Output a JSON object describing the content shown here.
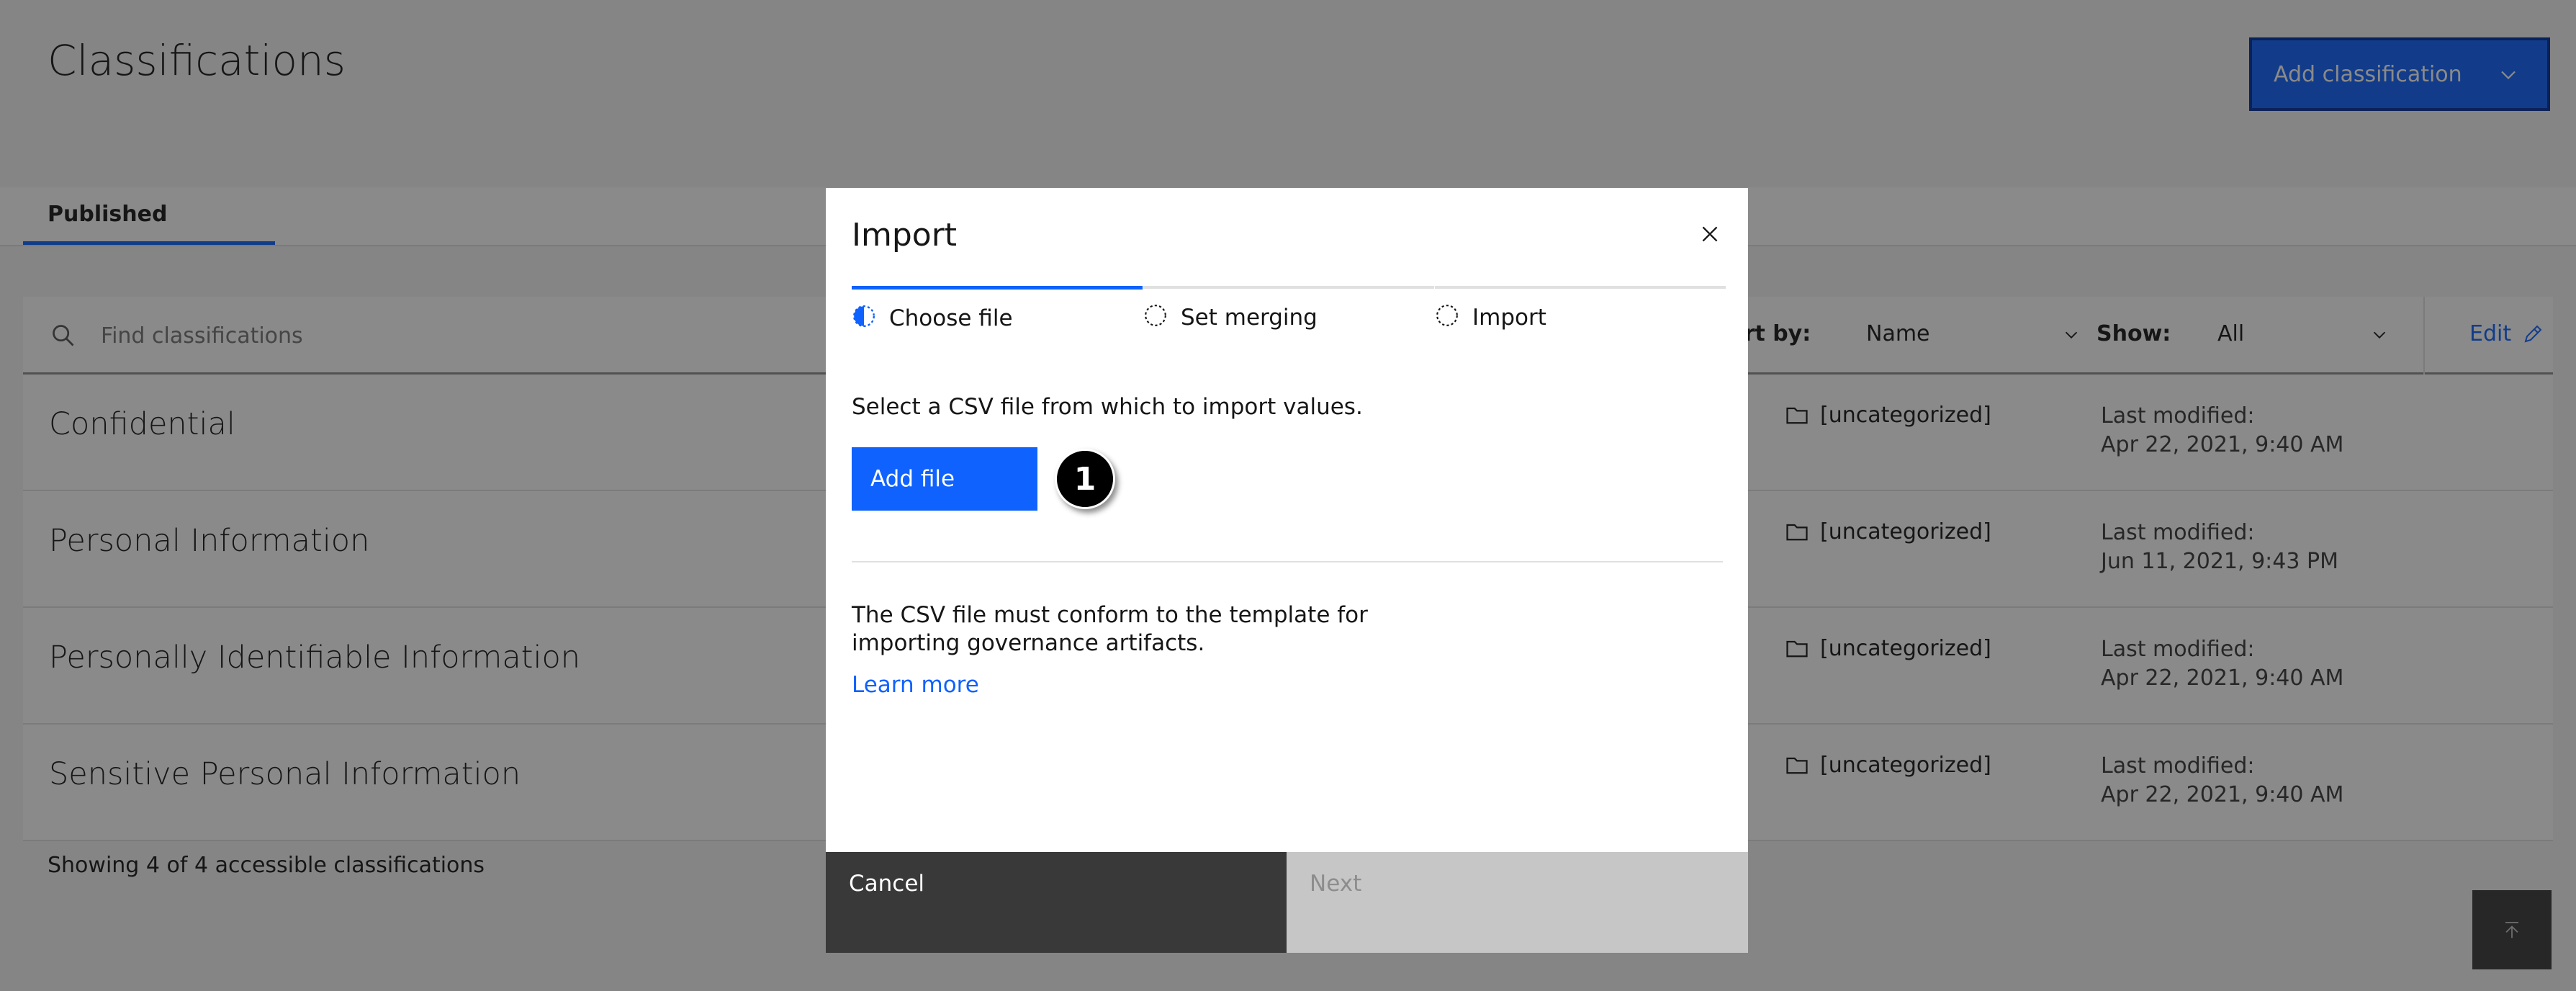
{
  "page": {
    "title": "Classifications",
    "add_button_label": "Add classification",
    "tabs": [
      {
        "label": "Published"
      }
    ],
    "search": {
      "placeholder": "Find classifications"
    },
    "sort_label": "ort by:",
    "sort_value": "Name",
    "show_label": "Show:",
    "show_value": "All",
    "edit_label": "Edit",
    "rows": [
      {
        "name": "Confidential",
        "category": "[uncategorized]",
        "modified_label": "Last modified:",
        "modified": "Apr 22, 2021, 9:40 AM"
      },
      {
        "name": "Personal Information",
        "category": "[uncategorized]",
        "modified_label": "Last modified:",
        "modified": "Jun 11, 2021, 9:43 PM"
      },
      {
        "name": "Personally Identifiable Information",
        "category": "[uncategorized]",
        "modified_label": "Last modified:",
        "modified": "Apr 22, 2021, 9:40 AM"
      },
      {
        "name": "Sensitive Personal Information",
        "category": "[uncategorized]",
        "modified_label": "Last modified:",
        "modified": "Apr 22, 2021, 9:40 AM"
      }
    ],
    "showing": "Showing 4 of 4 accessible classifications"
  },
  "modal": {
    "title": "Import",
    "steps": [
      {
        "label": "Choose file",
        "state": "active"
      },
      {
        "label": "Set merging",
        "state": "incomplete"
      },
      {
        "label": "Import",
        "state": "incomplete"
      }
    ],
    "instruction": "Select a CSV file from which to import values.",
    "add_file_label": "Add file",
    "callout_number": "1",
    "conform_text": "The CSV file must conform to the template for importing governance artifacts.",
    "learn_more": "Learn more",
    "cancel_label": "Cancel",
    "next_label": "Next"
  },
  "colors": {
    "accent": "#0f62fe",
    "overlay": "rgba(22,22,22,0.5)",
    "dark_button": "#393939",
    "disabled_button": "#c6c6c6"
  },
  "icons": [
    "search-icon",
    "chevron-down-icon",
    "edit-pencil-icon",
    "folder-icon",
    "close-icon",
    "step-progress-icon",
    "back-to-top-icon"
  ]
}
